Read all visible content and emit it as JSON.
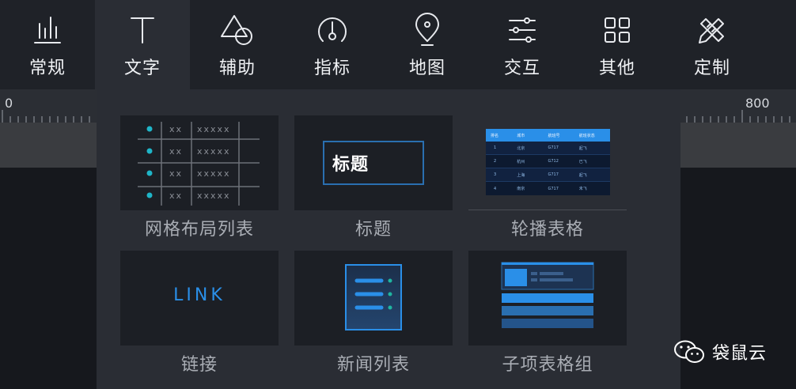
{
  "toolbar": {
    "items": [
      {
        "label": "常规",
        "icon": "bar-chart-icon"
      },
      {
        "label": "文字",
        "icon": "text-icon",
        "active": true
      },
      {
        "label": "辅助",
        "icon": "shapes-icon"
      },
      {
        "label": "指标",
        "icon": "gauge-icon"
      },
      {
        "label": "地图",
        "icon": "map-pin-icon"
      },
      {
        "label": "交互",
        "icon": "sliders-icon"
      },
      {
        "label": "其他",
        "icon": "grid-icon"
      },
      {
        "label": "定制",
        "icon": "pencil-ruler-icon"
      }
    ]
  },
  "ruler": {
    "left_value": "0",
    "right_value": "800"
  },
  "panel": {
    "cards": [
      {
        "label": "网格布局列表",
        "icon": "grid-list-thumbnail"
      },
      {
        "label": "标题",
        "icon": "title-thumbnail"
      },
      {
        "label": "轮播表格",
        "icon": "carousel-table-thumbnail"
      },
      {
        "label": "链接",
        "icon": "link-thumbnail"
      },
      {
        "label": "新闻列表",
        "icon": "news-list-thumbnail"
      },
      {
        "label": "子项表格组",
        "icon": "sub-table-group-thumbnail"
      }
    ],
    "grid_thumb": {
      "rows": [
        [
          "xx",
          "xxxxx"
        ],
        [
          "xx",
          "xxxxx"
        ],
        [
          "xx",
          "xxxxx"
        ],
        [
          "xx",
          "xxxxx"
        ]
      ]
    },
    "title_thumb": {
      "text": "标题"
    },
    "carousel_thumb": {
      "headers": [
        "排名",
        "城市",
        "航班号",
        "航班状态"
      ],
      "rows": [
        [
          "1",
          "北京",
          "G717",
          "起飞"
        ],
        [
          "2",
          "杭州",
          "G712",
          "已飞"
        ],
        [
          "3",
          "上海",
          "G717",
          "起飞"
        ],
        [
          "4",
          "南京",
          "G717",
          "未飞"
        ]
      ]
    },
    "link_thumb": {
      "text": "LINK"
    }
  },
  "watermark": {
    "text": "袋鼠云",
    "icon": "wechat-icon"
  },
  "colors": {
    "accent": "#2a8fe8",
    "teal_dot": "#1fb5c8",
    "toolbar_bg": "#1f2228",
    "panel_bg": "#2a2d34"
  }
}
